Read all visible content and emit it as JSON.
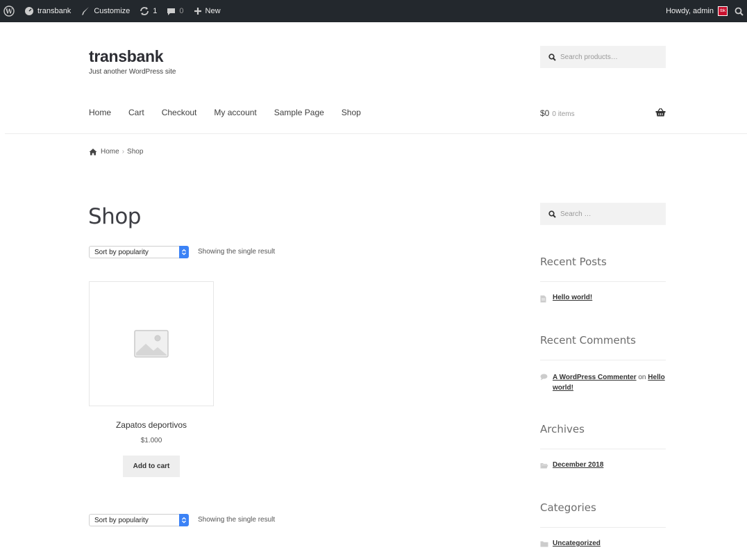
{
  "adminbar": {
    "site": "transbank",
    "customize": "Customize",
    "updates": "1",
    "comments": "0",
    "new": "New",
    "howdy": "Howdy, admin",
    "avatar_text": "tbk"
  },
  "header": {
    "title": "transbank",
    "tagline": "Just another WordPress site",
    "search_placeholder": "Search products…",
    "nav": [
      "Home",
      "Cart",
      "Checkout",
      "My account",
      "Sample Page",
      "Shop"
    ],
    "cart_amount": "$0",
    "cart_items": "0 items"
  },
  "breadcrumb": {
    "home": "Home",
    "sep": "›",
    "current": "Shop"
  },
  "main": {
    "title": "Shop",
    "sort_label": "Sort by popularity",
    "result_count": "Showing the single result",
    "product": {
      "name": "Zapatos deportivos",
      "price": "$1.000",
      "button": "Add to cart"
    }
  },
  "sidebar": {
    "search_placeholder": "Search …",
    "recent_posts_title": "Recent Posts",
    "recent_post": "Hello world!",
    "recent_comments_title": "Recent Comments",
    "comment_author": "A WordPress Commenter",
    "comment_on": "on",
    "comment_post": "Hello world!",
    "archives_title": "Archives",
    "archive": "December 2018",
    "categories_title": "Categories",
    "category": "Uncategorized"
  },
  "colors": {
    "adminbar": "#23282d",
    "sort_arrow": "#3b82f6",
    "avatar": "#c8102e"
  }
}
